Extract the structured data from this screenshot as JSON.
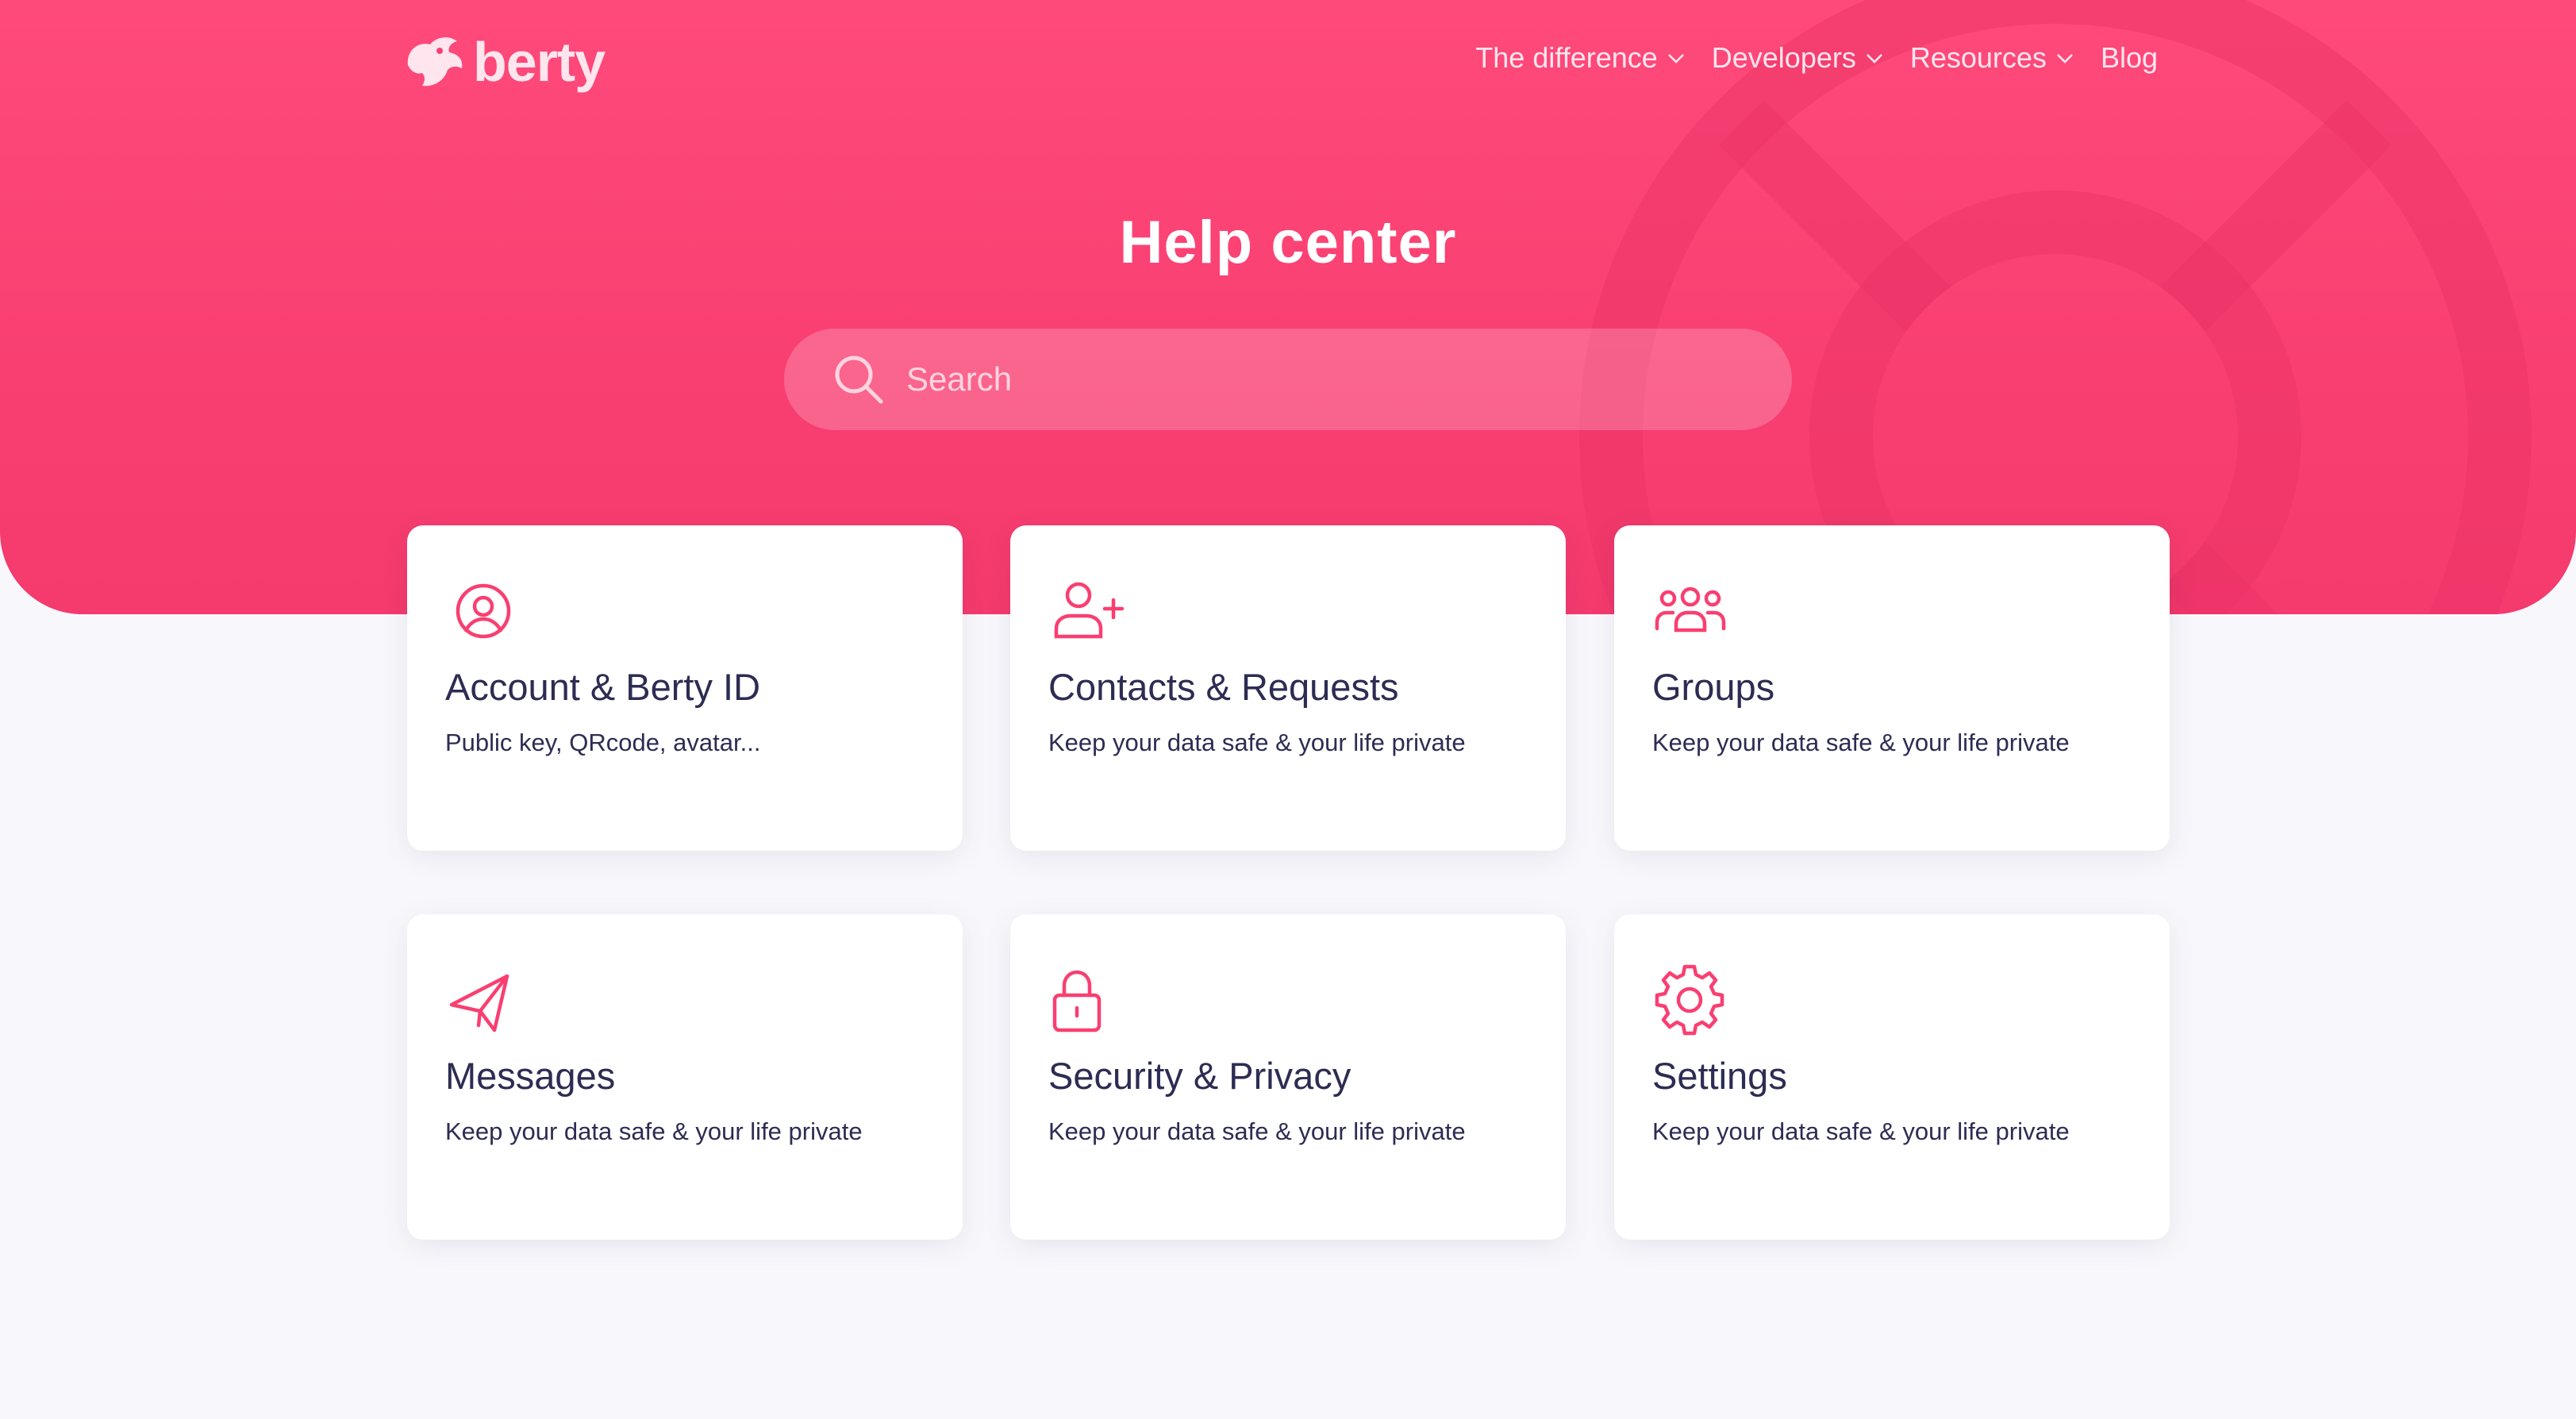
{
  "brand": {
    "name": "berty",
    "logo_icon": "bird-icon"
  },
  "nav": [
    {
      "label": "The difference",
      "has_dropdown": true
    },
    {
      "label": "Developers",
      "has_dropdown": true
    },
    {
      "label": "Resources",
      "has_dropdown": true
    },
    {
      "label": "Blog",
      "has_dropdown": false
    }
  ],
  "page": {
    "title": "Help center"
  },
  "search": {
    "placeholder": "Search",
    "value": "",
    "icon": "search-icon"
  },
  "categories": [
    {
      "title": "Account & Berty ID",
      "description": "Public key, QRcode, avatar...",
      "icon": "user-circle-icon"
    },
    {
      "title": "Contacts & Requests",
      "description": "Keep your data safe & your life private",
      "icon": "user-plus-icon"
    },
    {
      "title": "Groups",
      "description": "Keep your data safe & your life private",
      "icon": "users-icon"
    },
    {
      "title": "Messages",
      "description": "Keep your data safe & your life private",
      "icon": "send-icon"
    },
    {
      "title": "Security & Privacy",
      "description": "Keep your data safe & your life private",
      "icon": "lock-icon"
    },
    {
      "title": "Settings",
      "description": "Keep your data safe & your life private",
      "icon": "gear-icon"
    }
  ],
  "colors": {
    "accent": "#F93F71",
    "hero_bg": "#FE4A7B",
    "page_bg": "#F8F8FC",
    "text_dark": "#2D2C53",
    "nav_text": "#FFE6EE"
  }
}
